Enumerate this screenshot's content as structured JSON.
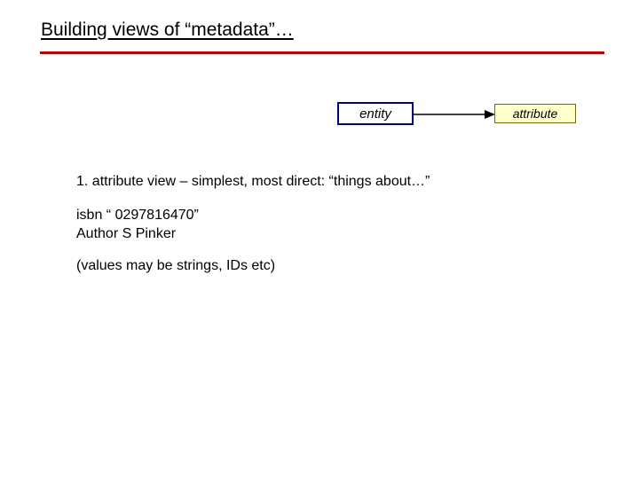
{
  "title": "Building views of “metadata”…",
  "diagram": {
    "entity_label": "entity",
    "attribute_label": "attribute"
  },
  "body": {
    "line1": "1. attribute view – simplest, most direct: “things about…”",
    "example_isbn": "isbn “ 0297816470”",
    "example_author": "Author S Pinker",
    "note": "(values may be strings, IDs etc)"
  }
}
